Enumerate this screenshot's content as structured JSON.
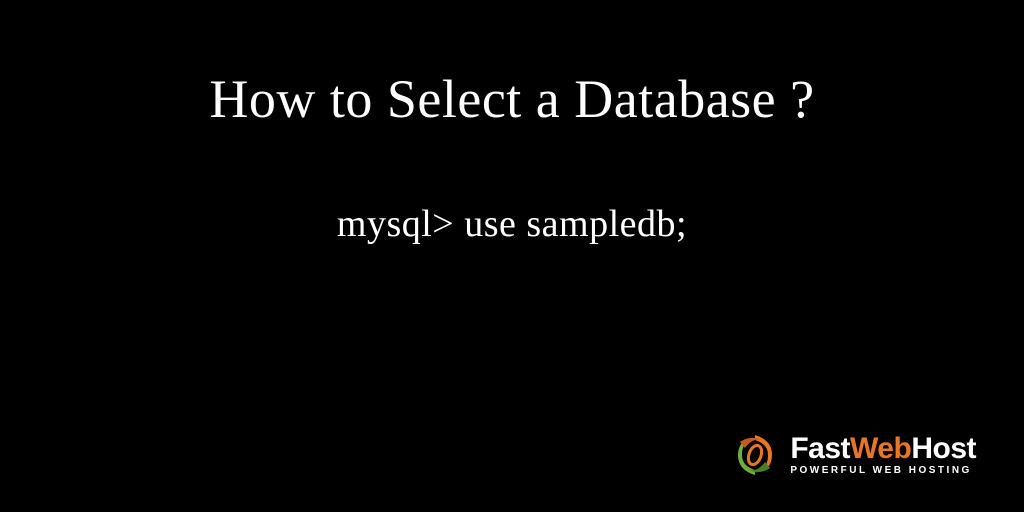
{
  "title": "How to Select a Database ?",
  "command": "mysql> use sampledb;",
  "logo": {
    "brand_part1": "Fast",
    "brand_part2": "Web",
    "brand_part3": "Host",
    "tagline": "POWERFUL WEB HOSTING",
    "colors": {
      "accent": "#e87724",
      "green": "#6fae3a",
      "dark_orange": "#c85a18"
    }
  }
}
